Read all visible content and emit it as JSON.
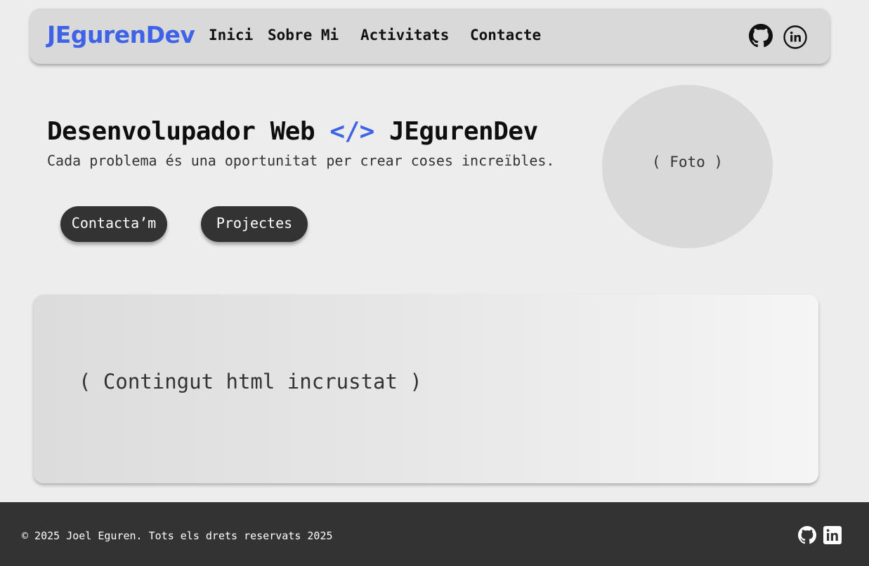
{
  "nav": {
    "brand": "JEgurenDev",
    "links": [
      "Inici",
      "Sobre Mi",
      "Activitats",
      "Contacte"
    ],
    "icons": [
      "github-icon",
      "linkedin-icon"
    ]
  },
  "hero": {
    "title_prefix": "Desenvolupador Web ",
    "title_code": "</>",
    "title_suffix": " JEgurenDev",
    "subtitle": "Cada problema és una oportunitat per crear coses increïbles.",
    "buttons": [
      "Contacta’m",
      "Projectes"
    ],
    "photo_placeholder": "( Foto )"
  },
  "embed": {
    "placeholder": "( Contingut html incrustat )"
  },
  "footer": {
    "copyright": "© 2025 Joel Eguren. Tots els drets reservats 2025",
    "icons": [
      "github-icon",
      "linkedin-icon"
    ]
  },
  "colors": {
    "accent": "#3f63e8",
    "background": "#ededed",
    "navbar": "#d9d9d9",
    "dark": "#333333"
  }
}
